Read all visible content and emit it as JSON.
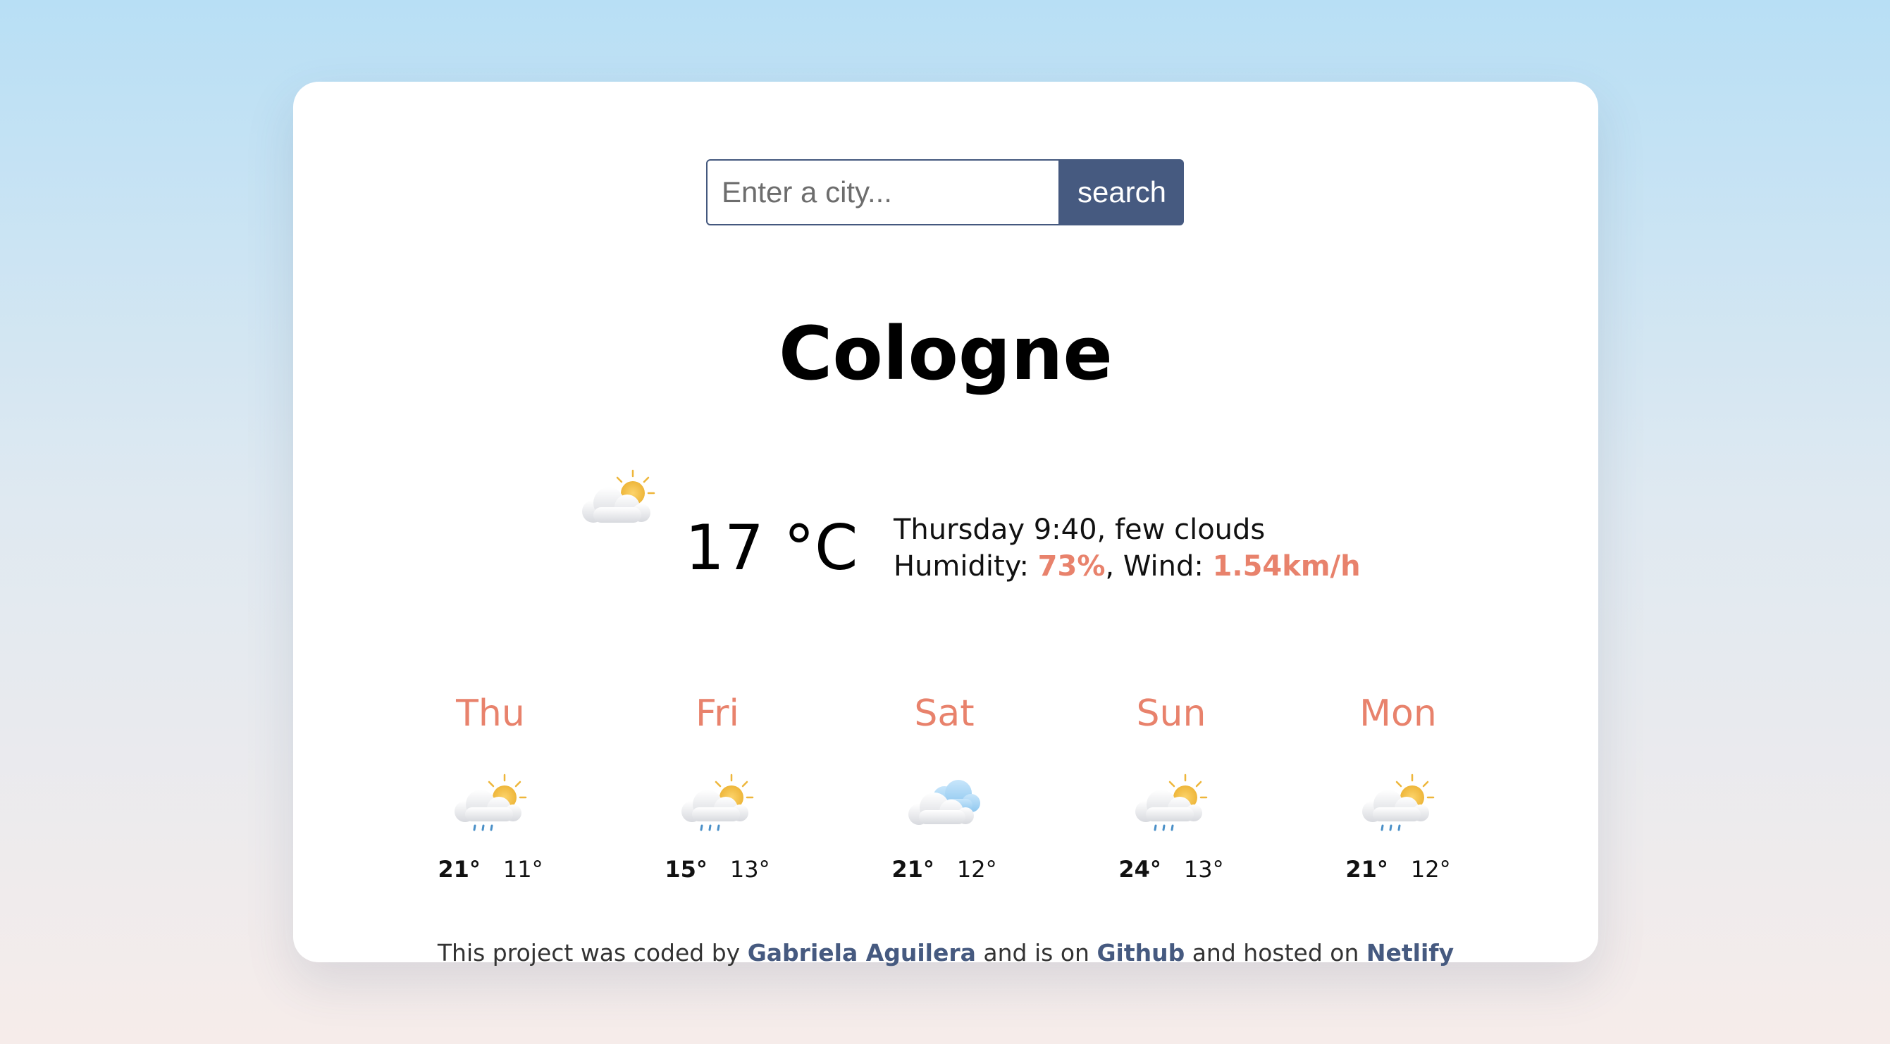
{
  "search": {
    "placeholder": "Enter a city...",
    "button_label": "search"
  },
  "current": {
    "city": "Cologne",
    "temperature": "17 °C",
    "description": "Thursday 9:40, few clouds",
    "humidity_label": "Humidity: ",
    "humidity_value": "73%",
    "wind_label": ", Wind: ",
    "wind_value": "1.54km/h",
    "icon": "few-clouds-icon"
  },
  "forecast": [
    {
      "day": "Thu",
      "icon": "rain-icon",
      "max": "21°",
      "min": "11°"
    },
    {
      "day": "Fri",
      "icon": "rain-icon",
      "max": "15°",
      "min": "13°"
    },
    {
      "day": "Sat",
      "icon": "cloudy-icon",
      "max": "21°",
      "min": "12°"
    },
    {
      "day": "Sun",
      "icon": "rain-icon",
      "max": "24°",
      "min": "13°"
    },
    {
      "day": "Mon",
      "icon": "rain-icon",
      "max": "21°",
      "min": "12°"
    }
  ],
  "footer": {
    "text_1": "This project was coded by ",
    "author_link": "Gabriela Aguilera",
    "text_2": " and is on ",
    "github_link": "Github",
    "text_3": " and hosted on ",
    "netlify_link": "Netlify"
  },
  "colors": {
    "accent": "#e8826c",
    "button": "#465a80",
    "link": "#465a80"
  }
}
